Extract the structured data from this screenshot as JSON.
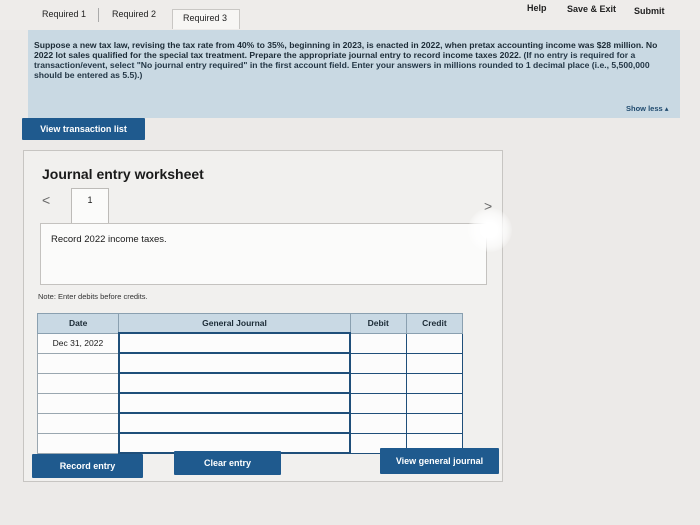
{
  "tabs": [
    {
      "label": "Required 1"
    },
    {
      "label": "Required 2"
    },
    {
      "label": "Required 3"
    }
  ],
  "toplinks": {
    "help": "Help",
    "save_exit": "Save & Exit",
    "submit": "Submit"
  },
  "instructions": {
    "text": "Suppose a new tax law, revising the tax rate from 40% to 35%, beginning in 2023, is enacted in 2022, when pretax accounting income was $28 million. No 2022 lot sales qualified for the special tax treatment. Prepare the appropriate journal entry to record income taxes 2022.",
    "note": "(If no entry is required for a transaction/event, select \"No journal entry required\" in the first account field. Enter your answers in millions rounded to 1 decimal place (i.e., 5,500,000 should be entered as 5.5).)",
    "show_less": "Show less ▴"
  },
  "view_transaction_list": "View transaction list",
  "worksheet": {
    "title": "Journal entry worksheet",
    "page_number": "1",
    "prev_arrow": "<",
    "next_arrow": ">",
    "record_text": "Record 2022 income taxes.",
    "note": "Note: Enter debits before credits.",
    "columns": {
      "date": "Date",
      "general_journal": "General Journal",
      "debit": "Debit",
      "credit": "Credit"
    },
    "rows": [
      {
        "date": "Dec 31, 2022",
        "account": "",
        "debit": "",
        "credit": ""
      },
      {
        "date": "",
        "account": "",
        "debit": "",
        "credit": ""
      },
      {
        "date": "",
        "account": "",
        "debit": "",
        "credit": ""
      },
      {
        "date": "",
        "account": "",
        "debit": "",
        "credit": ""
      },
      {
        "date": "",
        "account": "",
        "debit": "",
        "credit": ""
      },
      {
        "date": "",
        "account": "",
        "debit": "",
        "credit": ""
      }
    ],
    "buttons": {
      "record": "Record entry",
      "clear": "Clear entry",
      "view_general": "View general journal"
    }
  },
  "colors": {
    "accent": "#1f5a8e",
    "instruction_bg": "#c9d9e3"
  }
}
